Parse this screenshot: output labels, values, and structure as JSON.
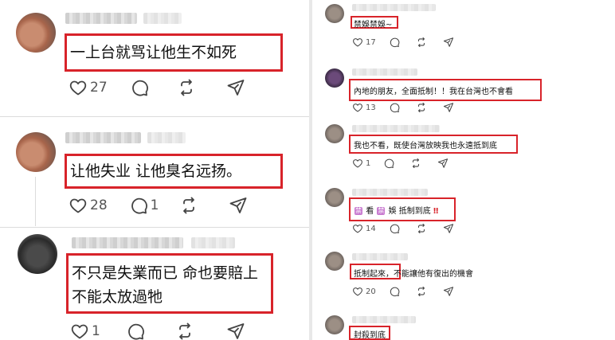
{
  "left_panel": {
    "comments": [
      {
        "text": "一上台就骂让他生不如死",
        "likes": "27",
        "replies": ""
      },
      {
        "text": "让他失业 让他臭名远扬。",
        "likes": "28",
        "replies": "1"
      },
      {
        "text_line1": "不只是失業而已 命也要賠上",
        "text_line2": "不能太放過牠",
        "likes": "1",
        "replies": ""
      }
    ]
  },
  "right_panel": {
    "comments": [
      {
        "text": "禁娛禁娛~",
        "likes": "17"
      },
      {
        "text": "內地的朋友，全面抵制！！我在台灣也不會看",
        "likes": "13"
      },
      {
        "text": "我也不看，既使台灣放映我也永遠抵到底",
        "likes": "1"
      },
      {
        "badge1": "禁",
        "text_a": "看",
        "badge2": "禁",
        "text_b": "娛 抵制到底",
        "text_end": "‼",
        "likes": "14"
      },
      {
        "text_boxed": "抵制起來，",
        "text_rest": "不能讓他有復出的機會",
        "likes": "20"
      },
      {
        "text": "封殺到底",
        "likes": ""
      }
    ]
  },
  "colors": {
    "highlight": "#d8232a",
    "badge": "#c87ad0",
    "icon": "#444444"
  },
  "icons": [
    "heart-icon",
    "comment-icon",
    "repost-icon",
    "share-icon"
  ]
}
